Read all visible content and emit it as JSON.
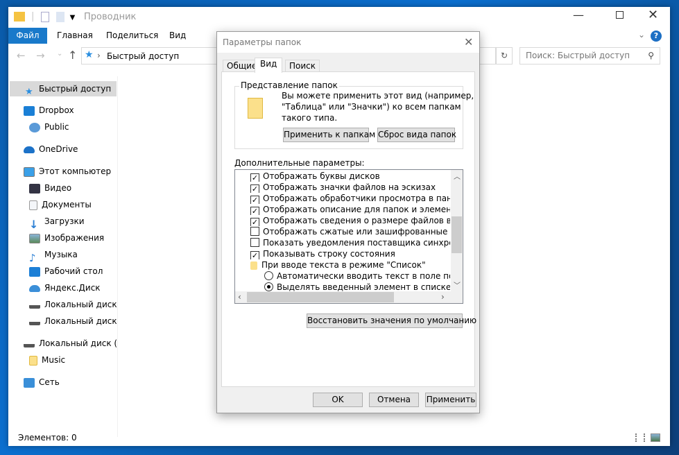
{
  "window": {
    "title": "Проводник",
    "ribbon_tabs": [
      "Файл",
      "Главная",
      "Поделиться",
      "Вид"
    ],
    "address": "Быстрый доступ",
    "search_placeholder": "Поиск: Быстрый доступ",
    "sidebar": [
      "Быстрый доступ",
      "Dropbox",
      "Public",
      "OneDrive",
      "Этот компьютер",
      "Видео",
      "Документы",
      "Загрузки",
      "Изображения",
      "Музыка",
      "Рабочий стол",
      "Яндекс.Диск",
      "Локальный диск (C:)",
      "Локальный диск (D:)",
      "Локальный диск (D:)",
      "Music",
      "Сеть"
    ],
    "status": "Элементов: 0"
  },
  "dialog": {
    "title": "Параметры папок",
    "tabs": [
      "Общие",
      "Вид",
      "Поиск"
    ],
    "group_title": "Представление папок",
    "group_text": [
      "Вы можете применить этот вид (например,",
      "\"Таблица\" или \"Значки\") ко всем папкам",
      "такого типа."
    ],
    "apply_folders": "Применить к папкам",
    "reset_folders": "Сброс вида папок",
    "advanced_label": "Дополнительные параметры:",
    "options": [
      {
        "label": "Отображать буквы дисков",
        "type": "check",
        "checked": true
      },
      {
        "label": "Отображать значки файлов на эскизах",
        "type": "check",
        "checked": true
      },
      {
        "label": "Отображать обработчики просмотра в панели просмотра",
        "type": "check",
        "checked": true
      },
      {
        "label": "Отображать описание для папок и элементов рабочего стола",
        "type": "check",
        "checked": true
      },
      {
        "label": "Отображать сведения о размере файлов в подсказках",
        "type": "check",
        "checked": true
      },
      {
        "label": "Отображать сжатые или зашифрованные файлы NTFS другим цветом",
        "type": "check",
        "checked": false
      },
      {
        "label": "Показать уведомления поставщика синхронизации",
        "type": "check",
        "checked": false
      },
      {
        "label": "Показывать строку состояния",
        "type": "check",
        "checked": true
      },
      {
        "label": "При вводе текста в режиме \"Список\"",
        "type": "folder"
      },
      {
        "label": "Автоматически вводить текст в поле поиска",
        "type": "radio",
        "checked": false
      },
      {
        "label": "Выделять введенный элемент в списке",
        "type": "radio",
        "checked": true
      }
    ],
    "restore": "Восстановить значения по умолчанию",
    "ok": "OK",
    "cancel": "Отмена",
    "apply": "Применить"
  }
}
